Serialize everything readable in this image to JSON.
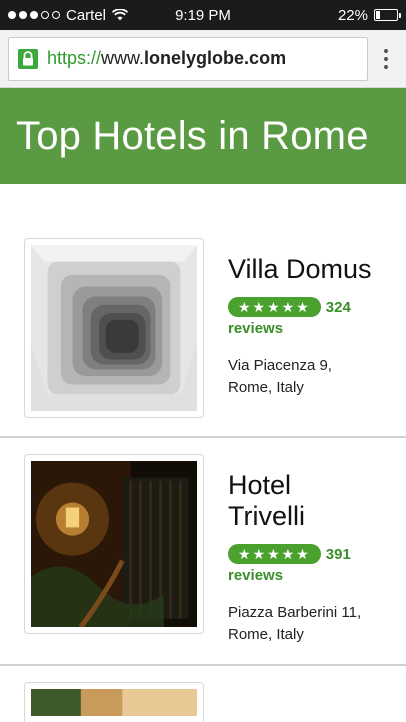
{
  "status_bar": {
    "carrier": "Cartel",
    "time": "9:19 PM",
    "battery": "22%",
    "battery_level": 0.22
  },
  "browser": {
    "url_scheme": "https://",
    "url_rest": "www.",
    "url_domain": "lonelyglobe.com",
    "lock_icon": "lock-icon",
    "menu_icon": "kebab-menu-icon"
  },
  "page": {
    "title": "Top Hotels in Rome"
  },
  "hotels": [
    {
      "name_line1": "Villa Domus",
      "name_line2": "",
      "stars": "★★★★★",
      "rating": 5,
      "review_count": "324",
      "review_label": "reviews",
      "address_line1": "Via Piacenza 9,",
      "address_line2": "Rome, Italy"
    },
    {
      "name_line1": "Hotel",
      "name_line2": "Trivelli",
      "stars": "★★★★★",
      "rating": 5,
      "review_count": "391",
      "review_label": "reviews",
      "address_line1": "Piazza Barberini 11,",
      "address_line2": "Rome, Italy"
    }
  ],
  "colors": {
    "banner_green": "#5a9a43",
    "rating_green": "#4aa12e",
    "link_green": "#3b8f2a"
  }
}
